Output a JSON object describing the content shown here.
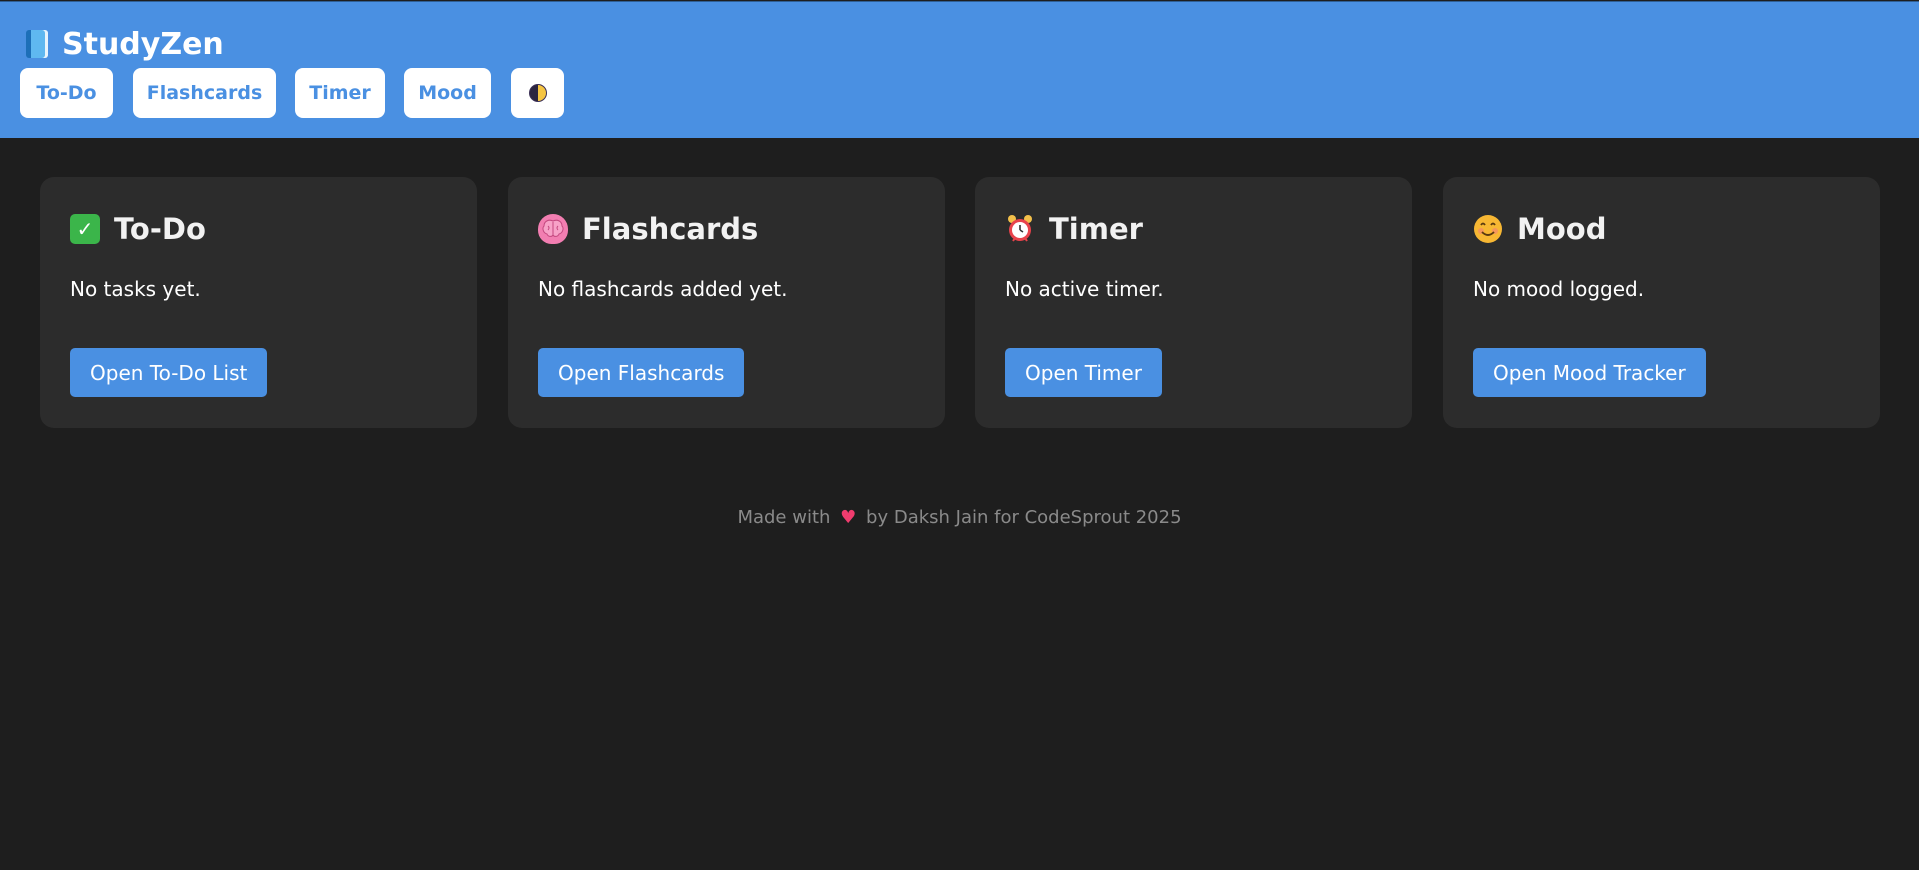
{
  "app": {
    "title": "StudyZen"
  },
  "nav": {
    "items": [
      {
        "label": "To-Do"
      },
      {
        "label": "Flashcards"
      },
      {
        "label": "Timer"
      },
      {
        "label": "Mood"
      }
    ],
    "theme_toggle_icon": "half-moon-icon"
  },
  "cards": [
    {
      "icon": "check-icon",
      "title": "To-Do",
      "text": "No tasks yet.",
      "button": "Open To-Do List"
    },
    {
      "icon": "brain-icon",
      "title": "Flashcards",
      "text": "No flashcards added yet.",
      "button": "Open Flashcards"
    },
    {
      "icon": "alarm-clock-icon",
      "title": "Timer",
      "text": "No active timer.",
      "button": "Open Timer"
    },
    {
      "icon": "smile-icon",
      "title": "Mood",
      "text": "No mood logged.",
      "button": "Open Mood Tracker"
    }
  ],
  "footer": {
    "prefix": "Made with",
    "heart": "♥",
    "suffix": "by Daksh Jain for CodeSprout 2025"
  },
  "colors": {
    "header": "#4a90e2",
    "background": "#1e1e1e",
    "card": "#2c2c2c",
    "accent": "#4a90e2"
  }
}
